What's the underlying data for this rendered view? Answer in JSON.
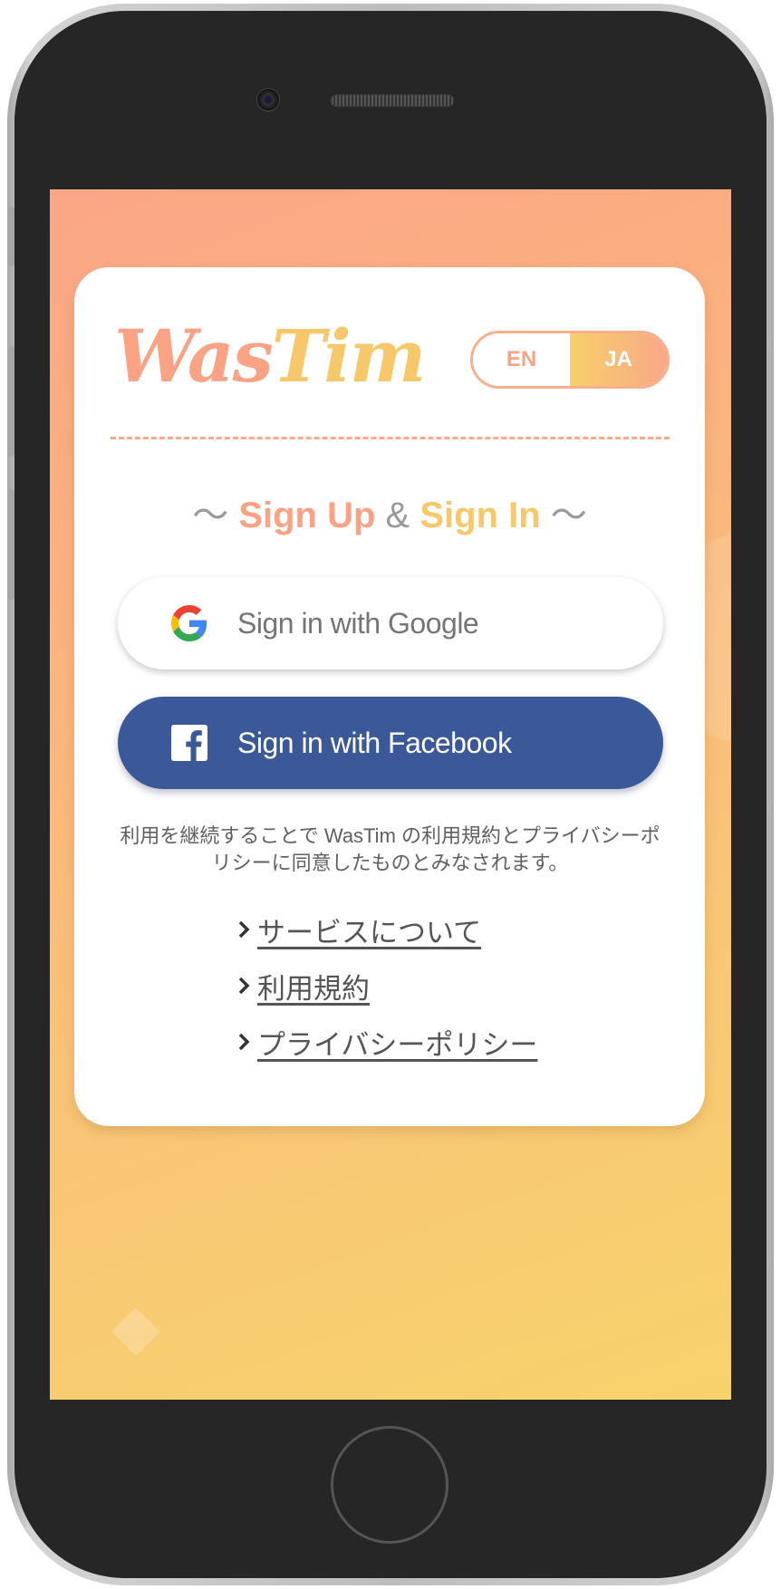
{
  "app": {
    "logo_part1": "Was",
    "logo_part2": "Tim"
  },
  "language_toggle": {
    "options": [
      "EN",
      "JA"
    ],
    "selected": "JA"
  },
  "heading": {
    "tilde_left": "〜",
    "sign_up": "Sign Up",
    "ampersand": "&",
    "sign_in": "Sign In",
    "tilde_right": "〜"
  },
  "auth_buttons": {
    "google_label": "Sign in with Google",
    "facebook_label": "Sign in with Facebook"
  },
  "notice": "利用を継続することで WasTim の利用規約とプライバシーポリシーに同意したものとみなされます。",
  "links": [
    {
      "label": "サービスについて"
    },
    {
      "label": "利用規約"
    },
    {
      "label": "プライバシーポリシー"
    }
  ],
  "colors": {
    "accent_orange": "#f9a284",
    "accent_yellow": "#f7c869",
    "facebook_blue": "#3b5998"
  }
}
